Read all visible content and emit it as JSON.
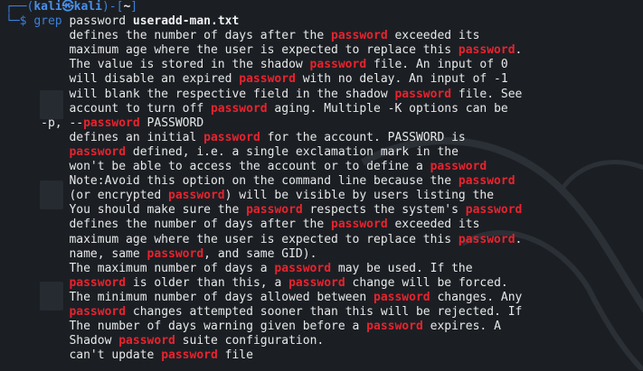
{
  "terminal": {
    "prompt": {
      "user": "kali",
      "at": "㉿",
      "host": "kali",
      "dir": "~"
    },
    "command": {
      "name": "grep",
      "arg": "password",
      "file": "useradd-man.txt"
    },
    "match": "password",
    "highlight_color": "#e8232e",
    "output": [
      [
        "         defines the number of days after the ",
        "password",
        " exceeded its"
      ],
      [
        "         maximum age where the user is expected to replace this ",
        "password",
        "."
      ],
      [
        "         The value is stored in the shadow ",
        "password",
        " file. An input of 0"
      ],
      [
        "         will disable an expired ",
        "password",
        " with no delay. An input of -1"
      ],
      [
        "         will blank the respective field in the shadow ",
        "password",
        " file. See"
      ],
      [
        "         account to turn off ",
        "password",
        " aging. Multiple -K options can be"
      ],
      [
        "     -p, --",
        "password",
        " PASSWORD"
      ],
      [
        "         defines an initial ",
        "password",
        " for the account. PASSWORD is"
      ],
      [
        "         ",
        "password",
        " defined, i.e. a single exclamation mark in the"
      ],
      [
        "         won't be able to access the account or to define a ",
        "password",
        ""
      ],
      [
        "         Note:Avoid this option on the command line because the ",
        "password",
        ""
      ],
      [
        "         (or encrypted ",
        "password",
        ") will be visible by users listing the"
      ],
      [
        "         You should make sure the ",
        "password",
        " respects the system's ",
        "password",
        ""
      ],
      [
        "         defines the number of days after the ",
        "password",
        " exceeded its"
      ],
      [
        "         maximum age where the user is expected to replace this ",
        "password",
        "."
      ],
      [
        "         name, same ",
        "password",
        ", and same GID)."
      ],
      [
        "         The maximum number of days a ",
        "password",
        " may be used. If the"
      ],
      [
        "         ",
        "password",
        " is older than this, a ",
        "password",
        " change will be forced."
      ],
      [
        "         The minimum number of days allowed between ",
        "password",
        " changes. Any"
      ],
      [
        "         ",
        "password",
        " changes attempted sooner than this will be rejected. If"
      ],
      [
        "         The number of days warning given before a ",
        "password",
        " expires. A"
      ],
      [
        "         Shadow ",
        "password",
        " suite configuration."
      ],
      [
        "         can't update ",
        "password",
        " file"
      ]
    ]
  }
}
